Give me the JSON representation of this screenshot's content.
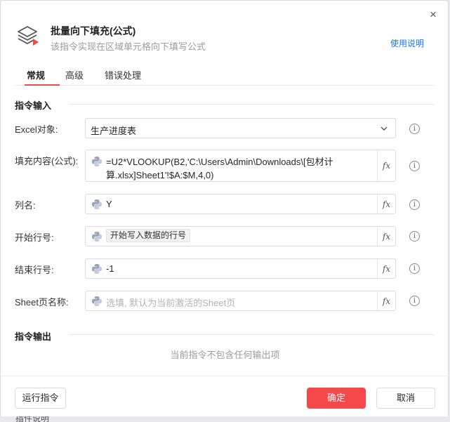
{
  "dialog": {
    "title": "批量向下填充(公式)",
    "subtitle": "该指令实现在区域单元格向下填写公式",
    "help_link": "使用说明",
    "close_icon": "×"
  },
  "tabs": [
    {
      "label": "常规",
      "active": true
    },
    {
      "label": "高级",
      "active": false
    },
    {
      "label": "错误处理",
      "active": false
    }
  ],
  "input_section": {
    "title": "指令输入",
    "fields": {
      "excel_object": {
        "label": "Excel对象:",
        "value": "生产进度表"
      },
      "fill_content": {
        "label": "填充内容(公式):",
        "value_line1": "=U2*VLOOKUP(B2,'C:\\Users\\Admin\\Downloads\\[包材计",
        "value_line2": "算.xlsx]Sheet1'!$A:$M,4,0)"
      },
      "column_name": {
        "label": "列名:",
        "value": "Y"
      },
      "start_row": {
        "label": "开始行号:",
        "value": "开始写入数据的行号"
      },
      "end_row": {
        "label": "结束行号:",
        "value": "-1"
      },
      "sheet_name": {
        "label": "Sheet页名称:",
        "placeholder": "选填, 默认为当前激活的Sheet页"
      }
    },
    "fx_label": "fx"
  },
  "output_section": {
    "title": "指令输出",
    "empty_text": "当前指令不包含任何输出项"
  },
  "footer": {
    "run_label": "运行指令",
    "ok_label": "确定",
    "cancel_label": "取消"
  },
  "colors": {
    "accent": "#f5484b",
    "link": "#1677ff",
    "python_blue": "#9aa4b8"
  },
  "icons": [
    "layers-icon",
    "close-icon",
    "chevron-down-icon",
    "python-icon",
    "fx-icon",
    "info-icon"
  ],
  "behind_text": "插件说明"
}
